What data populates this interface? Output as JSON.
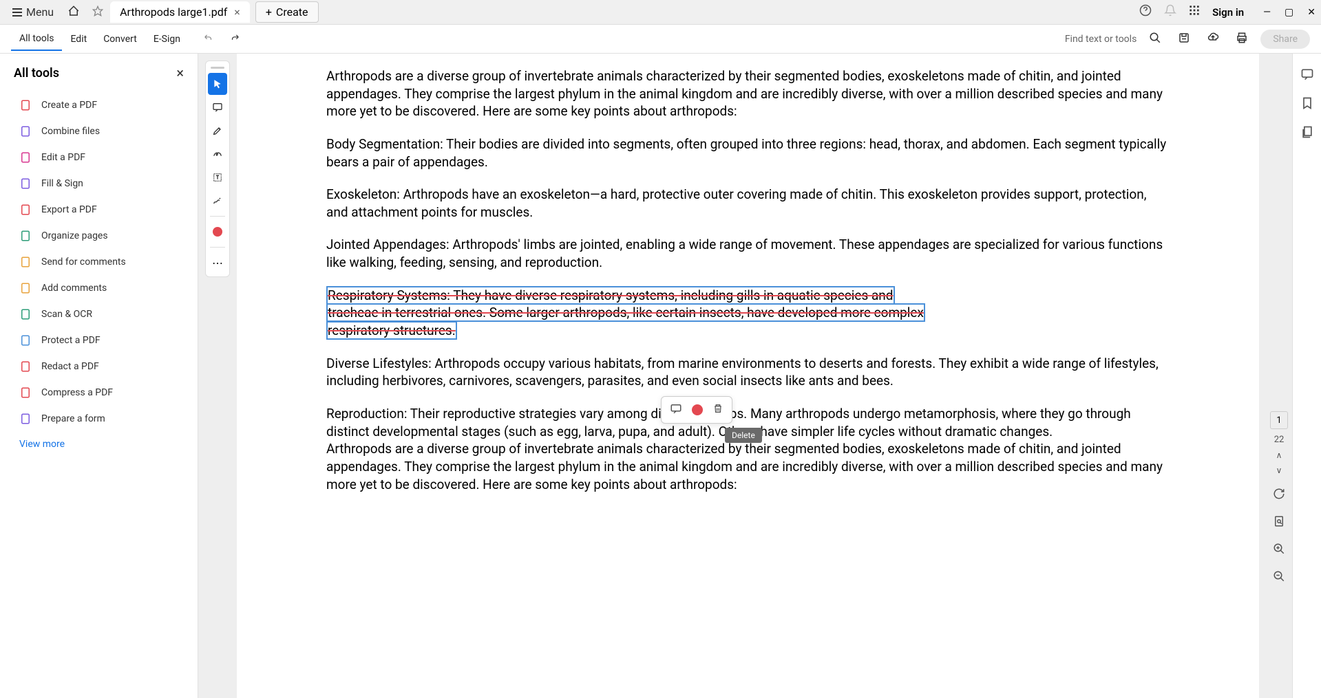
{
  "titlebar": {
    "menu_label": "Menu",
    "tab_title": "Arthropods large1.pdf",
    "create_label": "Create",
    "sign_in": "Sign in"
  },
  "toolbar": {
    "items": [
      "All tools",
      "Edit",
      "Convert",
      "E-Sign"
    ],
    "find_label": "Find text or tools",
    "share_label": "Share"
  },
  "sidebar": {
    "title": "All tools",
    "items": [
      {
        "label": "Create a PDF",
        "icon": "create-pdf-icon",
        "color": "#e34850"
      },
      {
        "label": "Combine files",
        "icon": "combine-icon",
        "color": "#7c5ce0"
      },
      {
        "label": "Edit a PDF",
        "icon": "edit-pdf-icon",
        "color": "#d83790"
      },
      {
        "label": "Fill & Sign",
        "icon": "fill-sign-icon",
        "color": "#7c5ce0"
      },
      {
        "label": "Export a PDF",
        "icon": "export-icon",
        "color": "#e34850"
      },
      {
        "label": "Organize pages",
        "icon": "organize-icon",
        "color": "#2d9d78"
      },
      {
        "label": "Send for comments",
        "icon": "send-comments-icon",
        "color": "#e8a33d"
      },
      {
        "label": "Add comments",
        "icon": "add-comments-icon",
        "color": "#e8a33d"
      },
      {
        "label": "Scan & OCR",
        "icon": "scan-icon",
        "color": "#2d9d78"
      },
      {
        "label": "Protect a PDF",
        "icon": "protect-icon",
        "color": "#4a90d9"
      },
      {
        "label": "Redact a PDF",
        "icon": "redact-icon",
        "color": "#e34850"
      },
      {
        "label": "Compress a PDF",
        "icon": "compress-icon",
        "color": "#e34850"
      },
      {
        "label": "Prepare a form",
        "icon": "form-icon",
        "color": "#7c5ce0"
      }
    ],
    "view_more": "View more"
  },
  "document": {
    "p1": "Arthropods are a diverse group of invertebrate animals characterized by their segmented bodies, exoskeletons made of chitin, and jointed appendages. They comprise the largest phylum in the animal kingdom and are incredibly diverse, with over a million described species and many more yet to be discovered. Here are some key points about arthropods:",
    "p2": "Body Segmentation: Their bodies are divided into segments, often grouped into three regions: head, thorax, and abdomen. Each segment typically bears a pair of appendages.",
    "p3": "Exoskeleton: Arthropods have an exoskeleton—a hard, protective outer covering made of chitin. This exoskeleton provides support, protection, and attachment points for muscles.",
    "p4": "Jointed Appendages: Arthropods' limbs are jointed, enabling a wide range of movement. These appendages are specialized for various functions like walking, feeding, sensing, and reproduction.",
    "p5_line1": "Respiratory Systems: They have diverse respiratory systems, including gills in aquatic species and",
    "p5_line2": "tracheae in terrestrial ones. Some larger arthropods, like certain insects, have developed more complex",
    "p5_line3": "respiratory structures.",
    "p6": "Diverse Lifestyles: Arthropods occupy various habitats, from marine environments to deserts and forests. They exhibit a wide range of lifestyles, including herbivores, carnivores, scavengers, parasites, and even social insects like ants and bees.",
    "p7": "Reproduction: Their reproductive strategies vary among different groups. Many arthropods undergo metamorphosis, where they go through distinct developmental stages (such as egg, larva, pupa, and adult). Others have simpler life cycles without dramatic changes.",
    "p8": "Arthropods are a diverse group of invertebrate animals characterized by their segmented bodies, exoskeletons made of chitin, and jointed appendages. They comprise the largest phylum in the animal kingdom and are incredibly diverse, with over a million described species and many more yet to be discovered. Here are some key points about arthropods:"
  },
  "tooltip": {
    "delete": "Delete"
  },
  "page_nav": {
    "current": "1",
    "total": "22"
  }
}
